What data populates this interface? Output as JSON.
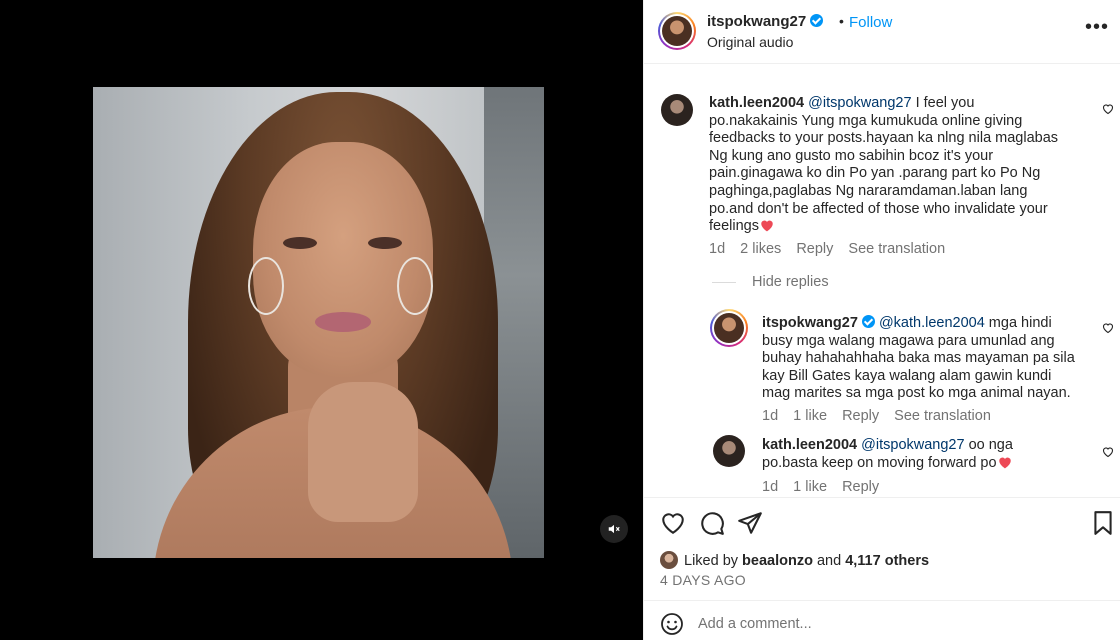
{
  "post": {
    "author": "itspokwang27",
    "follow_label": "Follow",
    "dot": "•",
    "audio": "Original audio",
    "more_label": "•••"
  },
  "comments": [
    {
      "username": "kath.leen2004",
      "mention": "@itspokwang27",
      "line1": " I feel you",
      "body": [
        "po.nakakainis Yung mga kumukuda online giving",
        "feedbacks to your posts.hayaan ka nlng nila maglabas",
        "Ng kung ano gusto mo sabihin bcoz it's your",
        "pain.ginagawa ko din Po yan .parang part ko Po Ng",
        "paghinga,paglabas Ng nararamdaman.laban lang",
        "po.and don't be affected of those who invalidate your",
        "feelings"
      ],
      "time": "1d",
      "likes": "2 likes",
      "reply": "Reply",
      "translate": "See translation",
      "hide_replies": "Hide replies"
    },
    {
      "username": "itspokwang27",
      "mention": "@kath.leen2004",
      "line1": " mga hindi",
      "body": [
        "busy mga walang magawa para umunlad ang",
        "buhay hahahahhaha baka mas mayaman pa sila",
        "kay Bill Gates kaya walang alam gawin kundi",
        "mag marites sa mga post ko mga animal nayan."
      ],
      "time": "1d",
      "likes": "1 like",
      "reply": "Reply",
      "translate": "See translation"
    },
    {
      "username": "kath.leen2004",
      "mention": "@itspokwang27",
      "line1": " oo nga",
      "body": [
        "po.basta keep on moving forward po"
      ],
      "time": "1d",
      "likes": "1 like",
      "reply": "Reply"
    }
  ],
  "engagement": {
    "liked_by_prefix": "Liked by ",
    "liked_by_user": "beaalonzo",
    "and": " and ",
    "others": "4,117 others",
    "date": "4 DAYS AGO"
  },
  "comment_box": {
    "placeholder": "Add a comment..."
  },
  "colors": {
    "accent": "#0095f6",
    "heart_red": "#ed4956",
    "muted": "#737373"
  }
}
